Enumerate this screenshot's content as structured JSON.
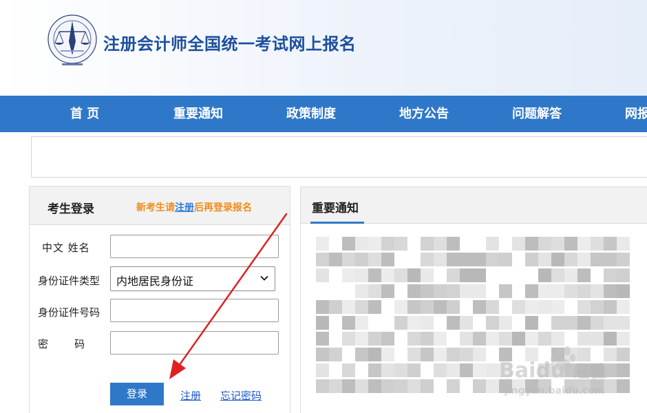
{
  "header": {
    "site_title": "注册会计师全国统一考试网上报名",
    "logo_icon": "cicpa-emblem-icon"
  },
  "nav": {
    "items": [
      {
        "label": "首 页"
      },
      {
        "label": "重要通知"
      },
      {
        "label": "政策制度"
      },
      {
        "label": "地方公告"
      },
      {
        "label": "问题解答"
      },
      {
        "label": "网报"
      }
    ]
  },
  "login": {
    "title": "考生登录",
    "tip_before": "新考生请",
    "tip_link": "注册",
    "tip_after": "后再登录报名",
    "fields": {
      "name_label": "中文 姓名",
      "name_value": "",
      "idtype_label": "身份证件类型",
      "idtype_value": "内地居民身份证",
      "idno_label": "身份证件号码",
      "idno_value": "",
      "password_label": "密        码",
      "password_value": ""
    },
    "login_button": "登录",
    "register_link": "注册",
    "forgot_link": "忘记密码"
  },
  "notices": {
    "title": "重要通知"
  },
  "watermark": {
    "brand": "Baidu",
    "brand_cn": "经验",
    "url": "jingyan.baidu.com"
  },
  "colors": {
    "nav_bg": "#2f78c9",
    "title_blue": "#1c4f9c",
    "tip_orange": "#f08c1a",
    "arrow_red": "#e02020"
  }
}
